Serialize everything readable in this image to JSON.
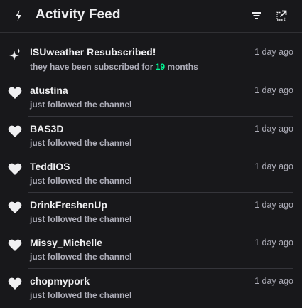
{
  "header": {
    "title": "Activity Feed",
    "icon": "bolt-icon",
    "filter_icon": "filter-icon",
    "popout_icon": "popout-icon"
  },
  "colors": {
    "background": "#18181b",
    "text": "#efeff1",
    "muted": "#adadb8",
    "highlight": "#00f593",
    "divider": "#35353b"
  },
  "events": [
    {
      "type": "resubscribe",
      "icon": "sparkle-icon",
      "title": "ISUweather Resubscribed!",
      "detail_prefix": "they have been subscribed for ",
      "detail_count": "19",
      "detail_suffix": " months",
      "time": "1 day ago"
    },
    {
      "type": "follow",
      "icon": "heart-icon",
      "title": "atustina",
      "detail": "just followed the channel",
      "time": "1 day ago"
    },
    {
      "type": "follow",
      "icon": "heart-icon",
      "title": "BAS3D",
      "detail": "just followed the channel",
      "time": "1 day ago"
    },
    {
      "type": "follow",
      "icon": "heart-icon",
      "title": "TeddIOS",
      "detail": "just followed the channel",
      "time": "1 day ago"
    },
    {
      "type": "follow",
      "icon": "heart-icon",
      "title": "DrinkFreshenUp",
      "detail": "just followed the channel",
      "time": "1 day ago"
    },
    {
      "type": "follow",
      "icon": "heart-icon",
      "title": "Missy_Michelle",
      "detail": "just followed the channel",
      "time": "1 day ago"
    },
    {
      "type": "follow",
      "icon": "heart-icon",
      "title": "chopmypork",
      "detail": "just followed the channel",
      "time": "1 day ago"
    }
  ]
}
